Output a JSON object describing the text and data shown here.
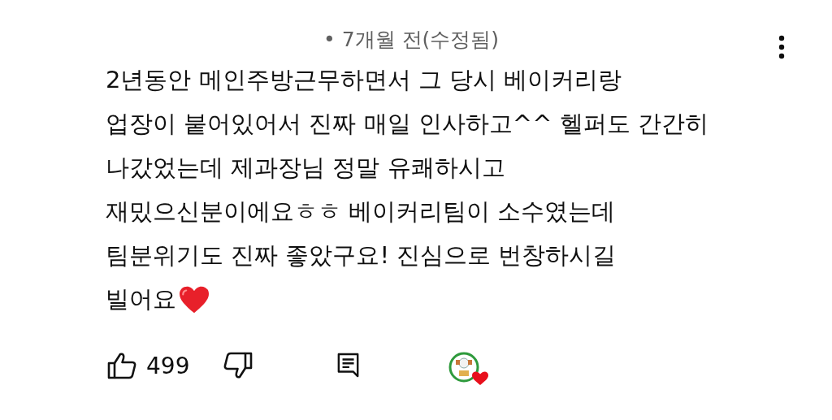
{
  "comment": {
    "timestamp": "• 7개월 전(수정됨)",
    "lines": [
      "2년동안 메인주방근무하면서 그 당시 베이커리랑",
      "업장이 붙어있어서 진짜 매일 인사하고^^ 헬퍼도 간간히",
      "나갔었는데 제과장님 정말 유쾌하시고",
      "재밌으신분이에요ㅎㅎ 베이커리팀이 소수였는데",
      "팀분위기도 진짜 좋았구요!  진심으로 번창하시길",
      "빌어요"
    ],
    "ends_with_heart": true,
    "likes": "499",
    "creator_hearted": true
  }
}
